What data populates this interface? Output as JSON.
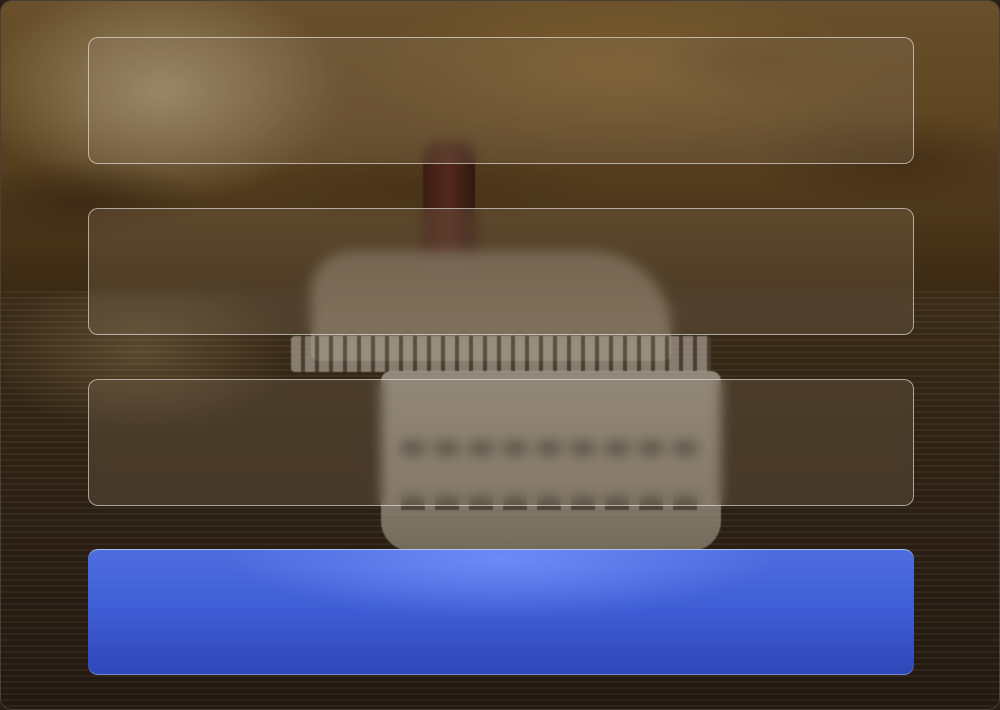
{
  "form": {
    "fields": [
      {
        "value": "",
        "placeholder": ""
      },
      {
        "value": "",
        "placeholder": ""
      },
      {
        "value": "",
        "placeholder": ""
      }
    ],
    "submit_label": ""
  },
  "colors": {
    "accent": "#3e5cd4",
    "field_border": "#ffffff"
  }
}
